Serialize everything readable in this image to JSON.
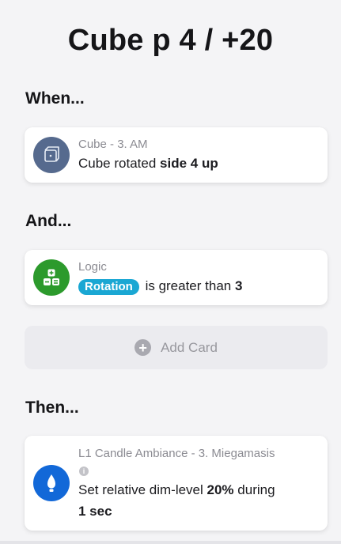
{
  "page": {
    "title": "Cube p 4 / +20"
  },
  "when": {
    "heading": "When...",
    "card": {
      "subtitle": "Cube - 3. AM",
      "text": "Cube rotated",
      "value": "side 4 up",
      "icon": "cube-icon",
      "icon_color": "#566a8e"
    }
  },
  "and": {
    "heading": "And...",
    "card": {
      "subtitle": "Logic",
      "tag": "Rotation",
      "text": "is greater than",
      "value": "3",
      "icon": "logic-icon",
      "icon_color": "#2c9a2c"
    },
    "add_card_label": "Add Card"
  },
  "then": {
    "heading": "Then...",
    "card": {
      "subtitle": "L1 Candle Ambiance - 3. Miegamasis",
      "text_prefix": "Set relative dim-level",
      "value": "20%",
      "text_mid": "during",
      "duration": "1 sec",
      "icon": "candle-bulb-icon",
      "icon_color": "#1268d8"
    }
  }
}
